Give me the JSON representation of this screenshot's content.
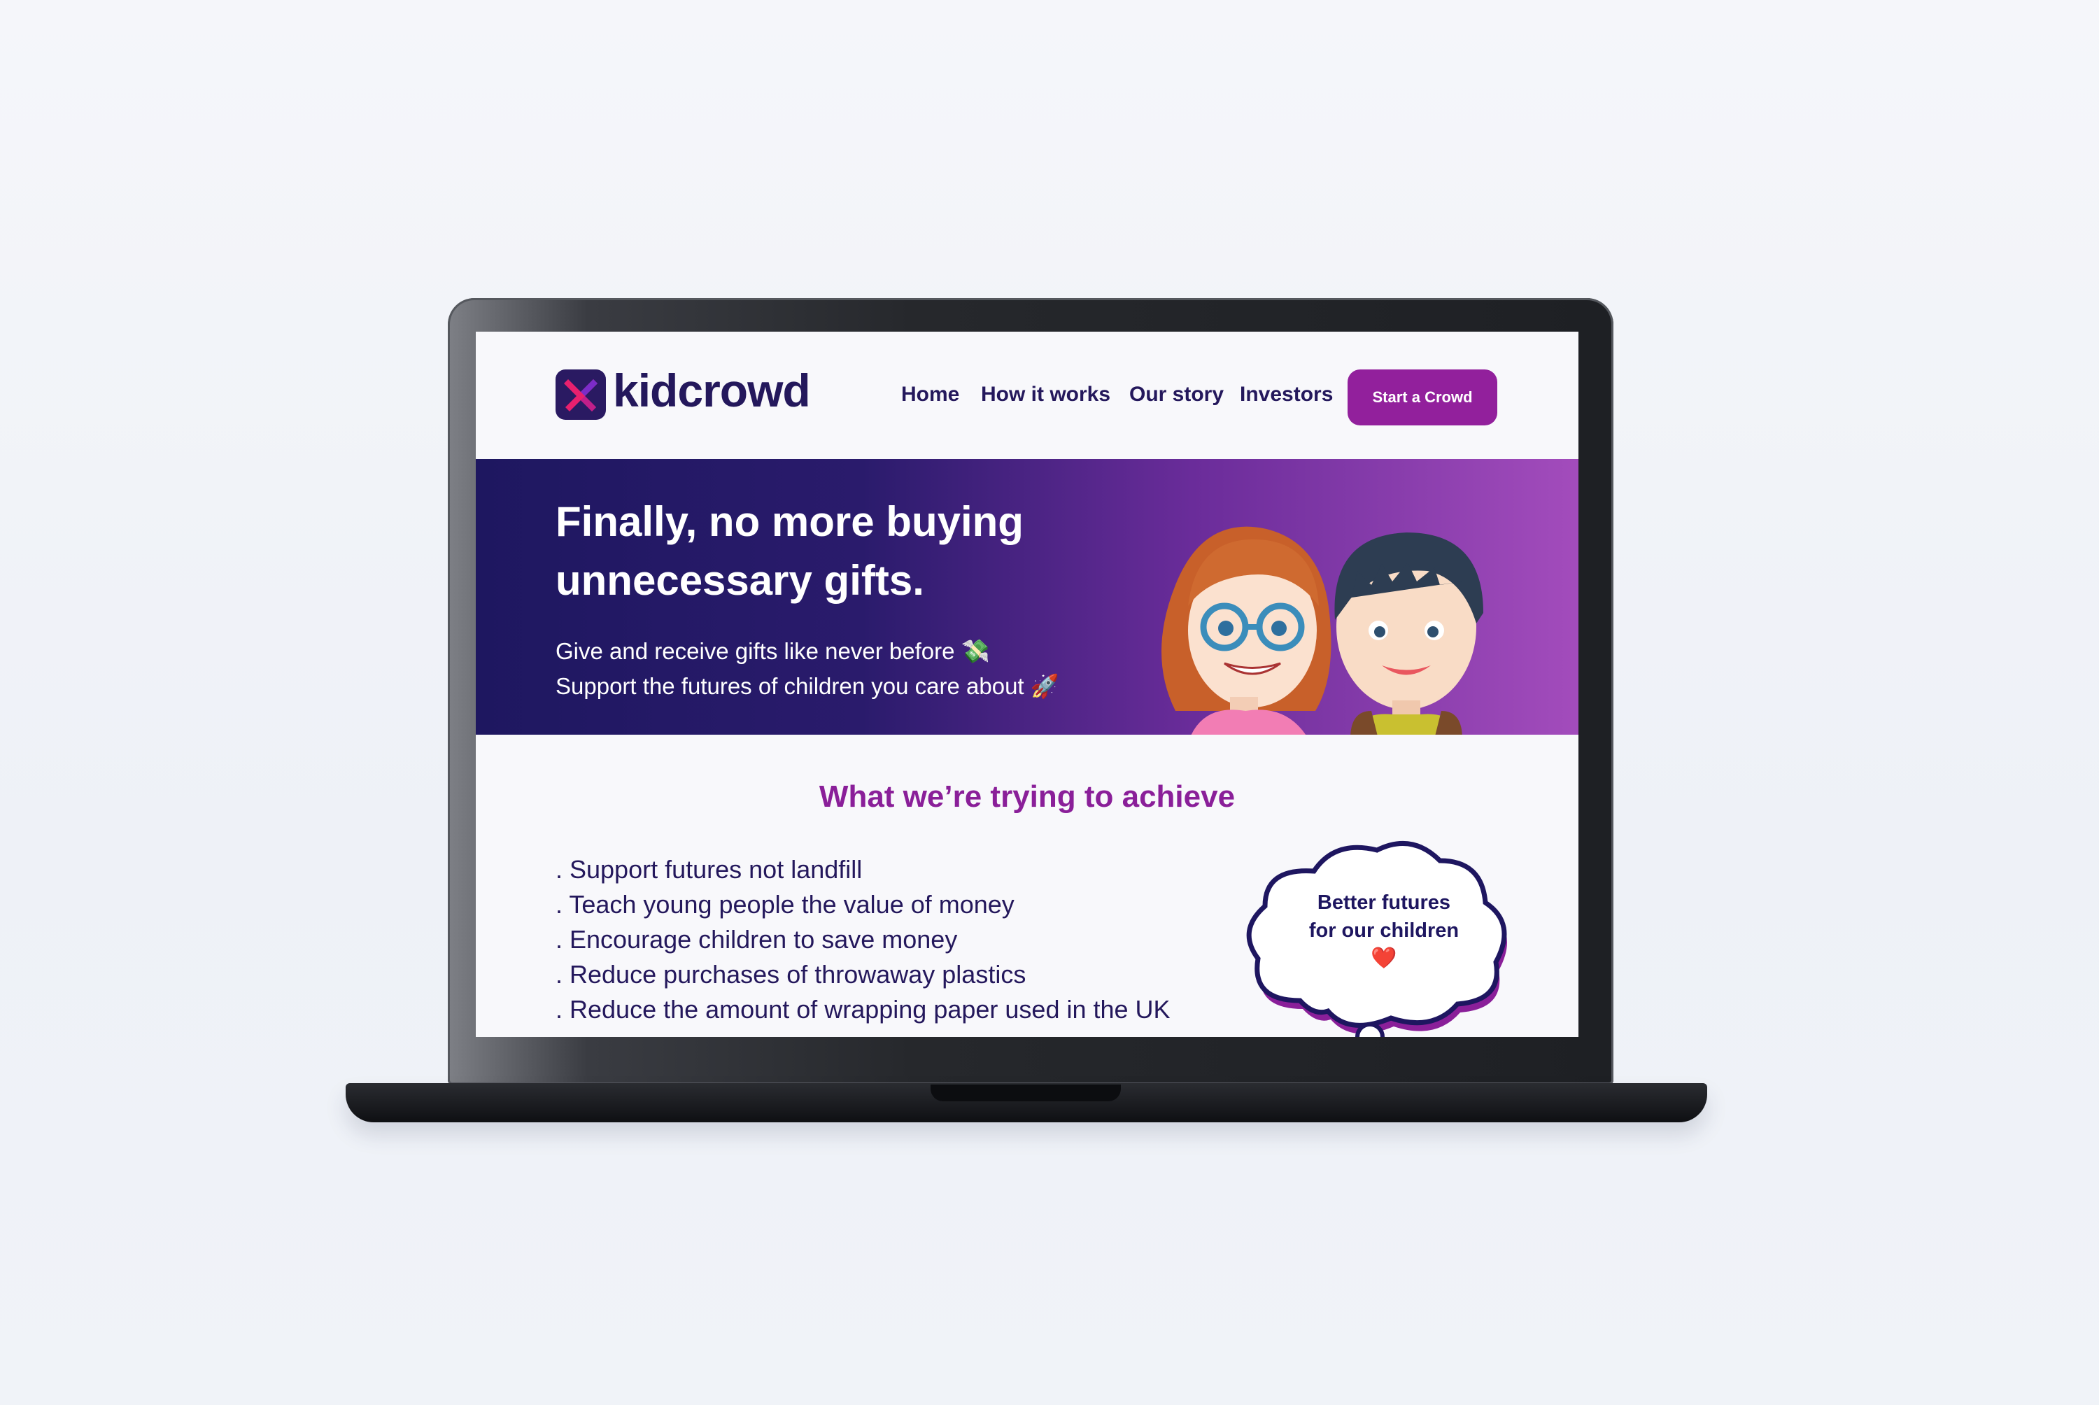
{
  "brand": {
    "name": "kidcrowd",
    "logo_icon": "kidcrowd-x-logo-icon"
  },
  "nav": {
    "links": [
      "Home",
      "How it works",
      "Our story",
      "Investors"
    ],
    "cta_label": "Start a Crowd"
  },
  "hero": {
    "title": "Finally, no more buying unnecessary gifts.",
    "line1": "Give and receive gifts like never before 💸",
    "line2": "Support the futures of children you care about 🚀"
  },
  "section": {
    "title": "What we’re trying to achieve",
    "goals": [
      ". Support futures not landfill",
      ". Teach young people the value of money",
      ". Encourage children to save money",
      ". Reduce purchases of throwaway plastics",
      ". Reduce the amount of wrapping paper used in the UK"
    ]
  },
  "bubble": {
    "line1": "Better futures",
    "line2": "for our children",
    "emoji": "❤️"
  },
  "colors": {
    "navy": "#24185c",
    "purple": "#92209c",
    "hero_start": "#1e1760",
    "hero_end": "#a34cbc"
  }
}
